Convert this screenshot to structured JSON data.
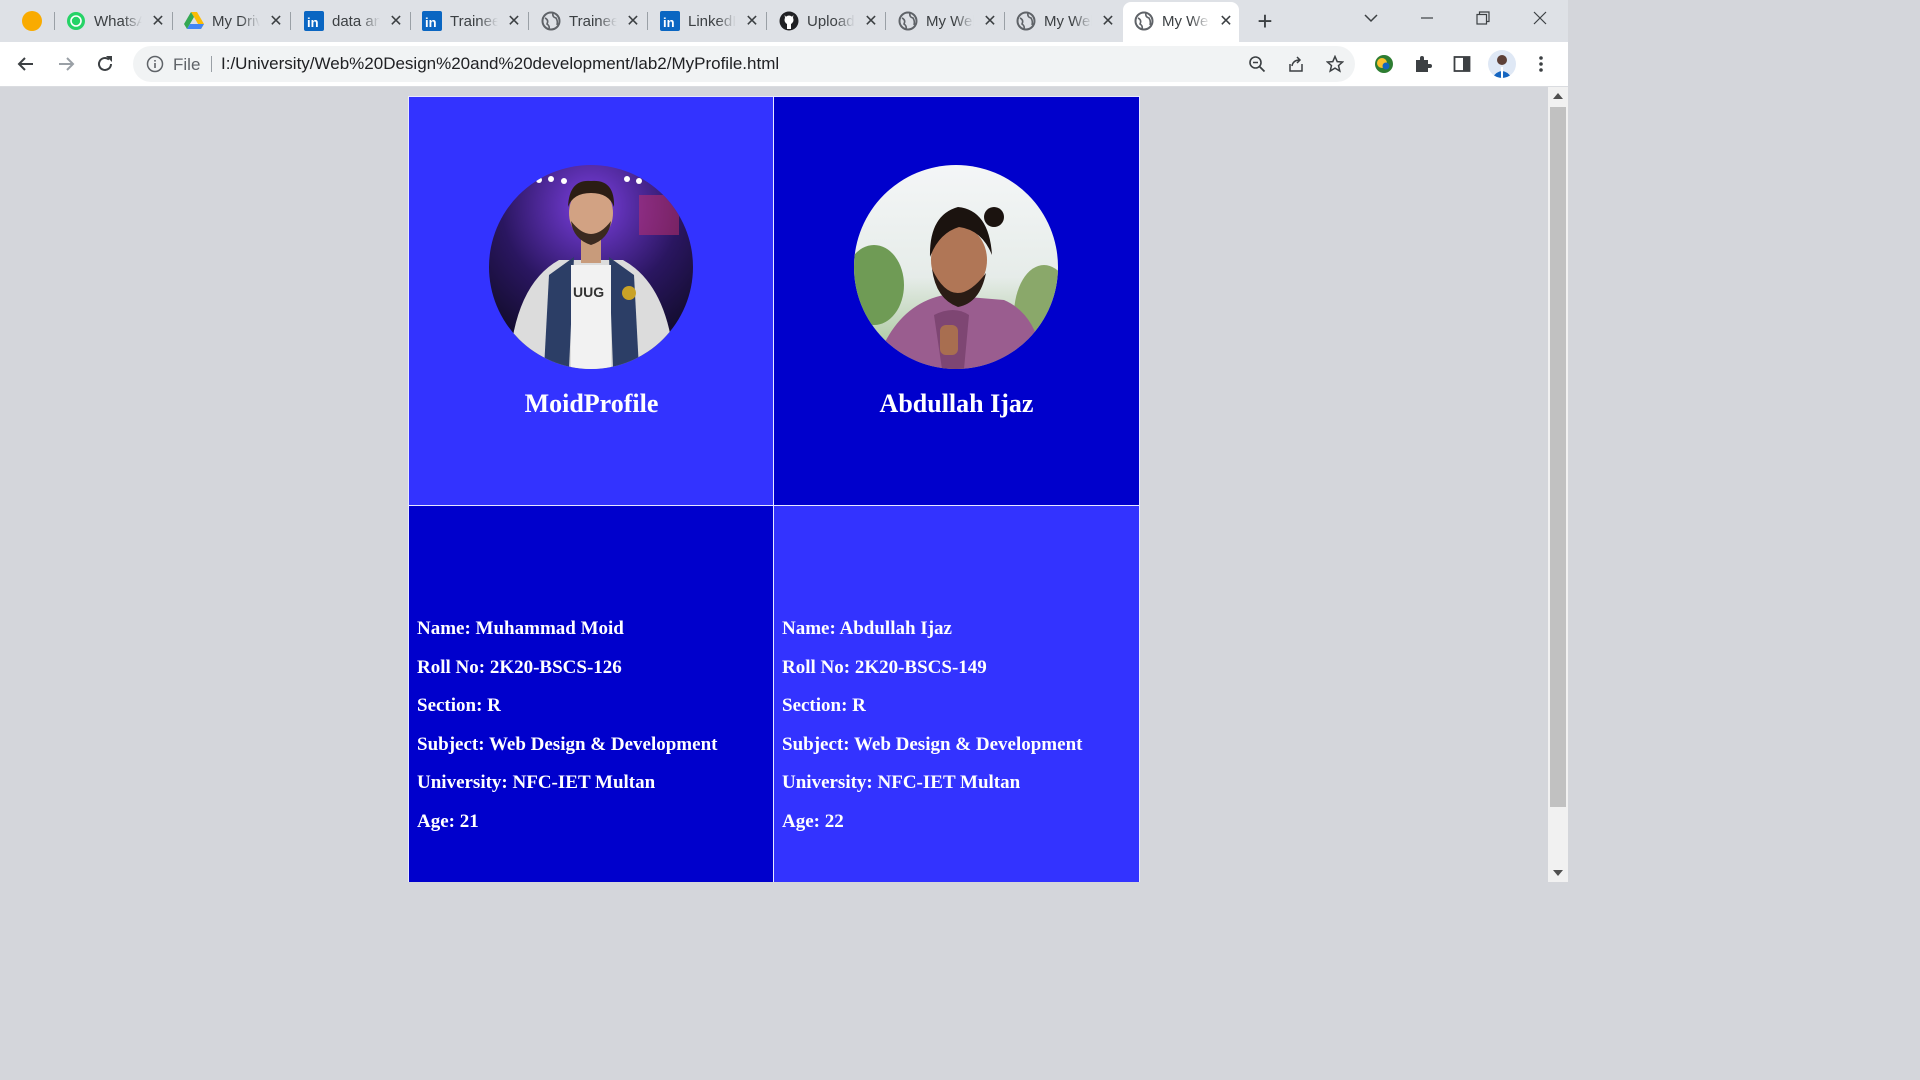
{
  "browser": {
    "tabs": [
      {
        "label": "WhatsApp",
        "icon": "whatsapp-icon"
      },
      {
        "label": "My Drive",
        "icon": "google-drive-icon"
      },
      {
        "label": "data analyst",
        "icon": "linkedin-icon"
      },
      {
        "label": "Trainee",
        "icon": "linkedin-icon"
      },
      {
        "label": "Trainee",
        "icon": "globe-icon"
      },
      {
        "label": "LinkedIn",
        "icon": "linkedin-icon"
      },
      {
        "label": "Upload",
        "icon": "github-icon"
      },
      {
        "label": "My Website",
        "icon": "globe-icon"
      },
      {
        "label": "My Website",
        "icon": "globe-icon"
      },
      {
        "label": "My Website",
        "icon": "globe-icon",
        "active": true
      }
    ],
    "address": {
      "scheme_label": "File",
      "url": "I:/University/Web%20Design%20and%20development/lab2/MyProfile.html"
    }
  },
  "profiles": [
    {
      "name": "MoidProfile",
      "avatar_icon": "profile-photo",
      "info": [
        "Name: Muhammad Moid",
        "Roll No: 2K20-BSCS-126",
        "Section: R",
        "Subject: Web Design & Development",
        "University: NFC-IET Multan",
        "Age: 21"
      ]
    },
    {
      "name": "Abdullah Ijaz",
      "avatar_icon": "profile-photo",
      "info": [
        "Name: Abdullah Ijaz",
        "Roll No: 2K20-BSCS-149",
        "Section: R",
        "Subject: Web Design & Development",
        "University: NFC-IET Multan",
        "Age: 22"
      ]
    }
  ],
  "colors": {
    "light_cell": "#3333ff",
    "dark_cell": "#0000cc",
    "page_bg": "#d4d6db"
  }
}
